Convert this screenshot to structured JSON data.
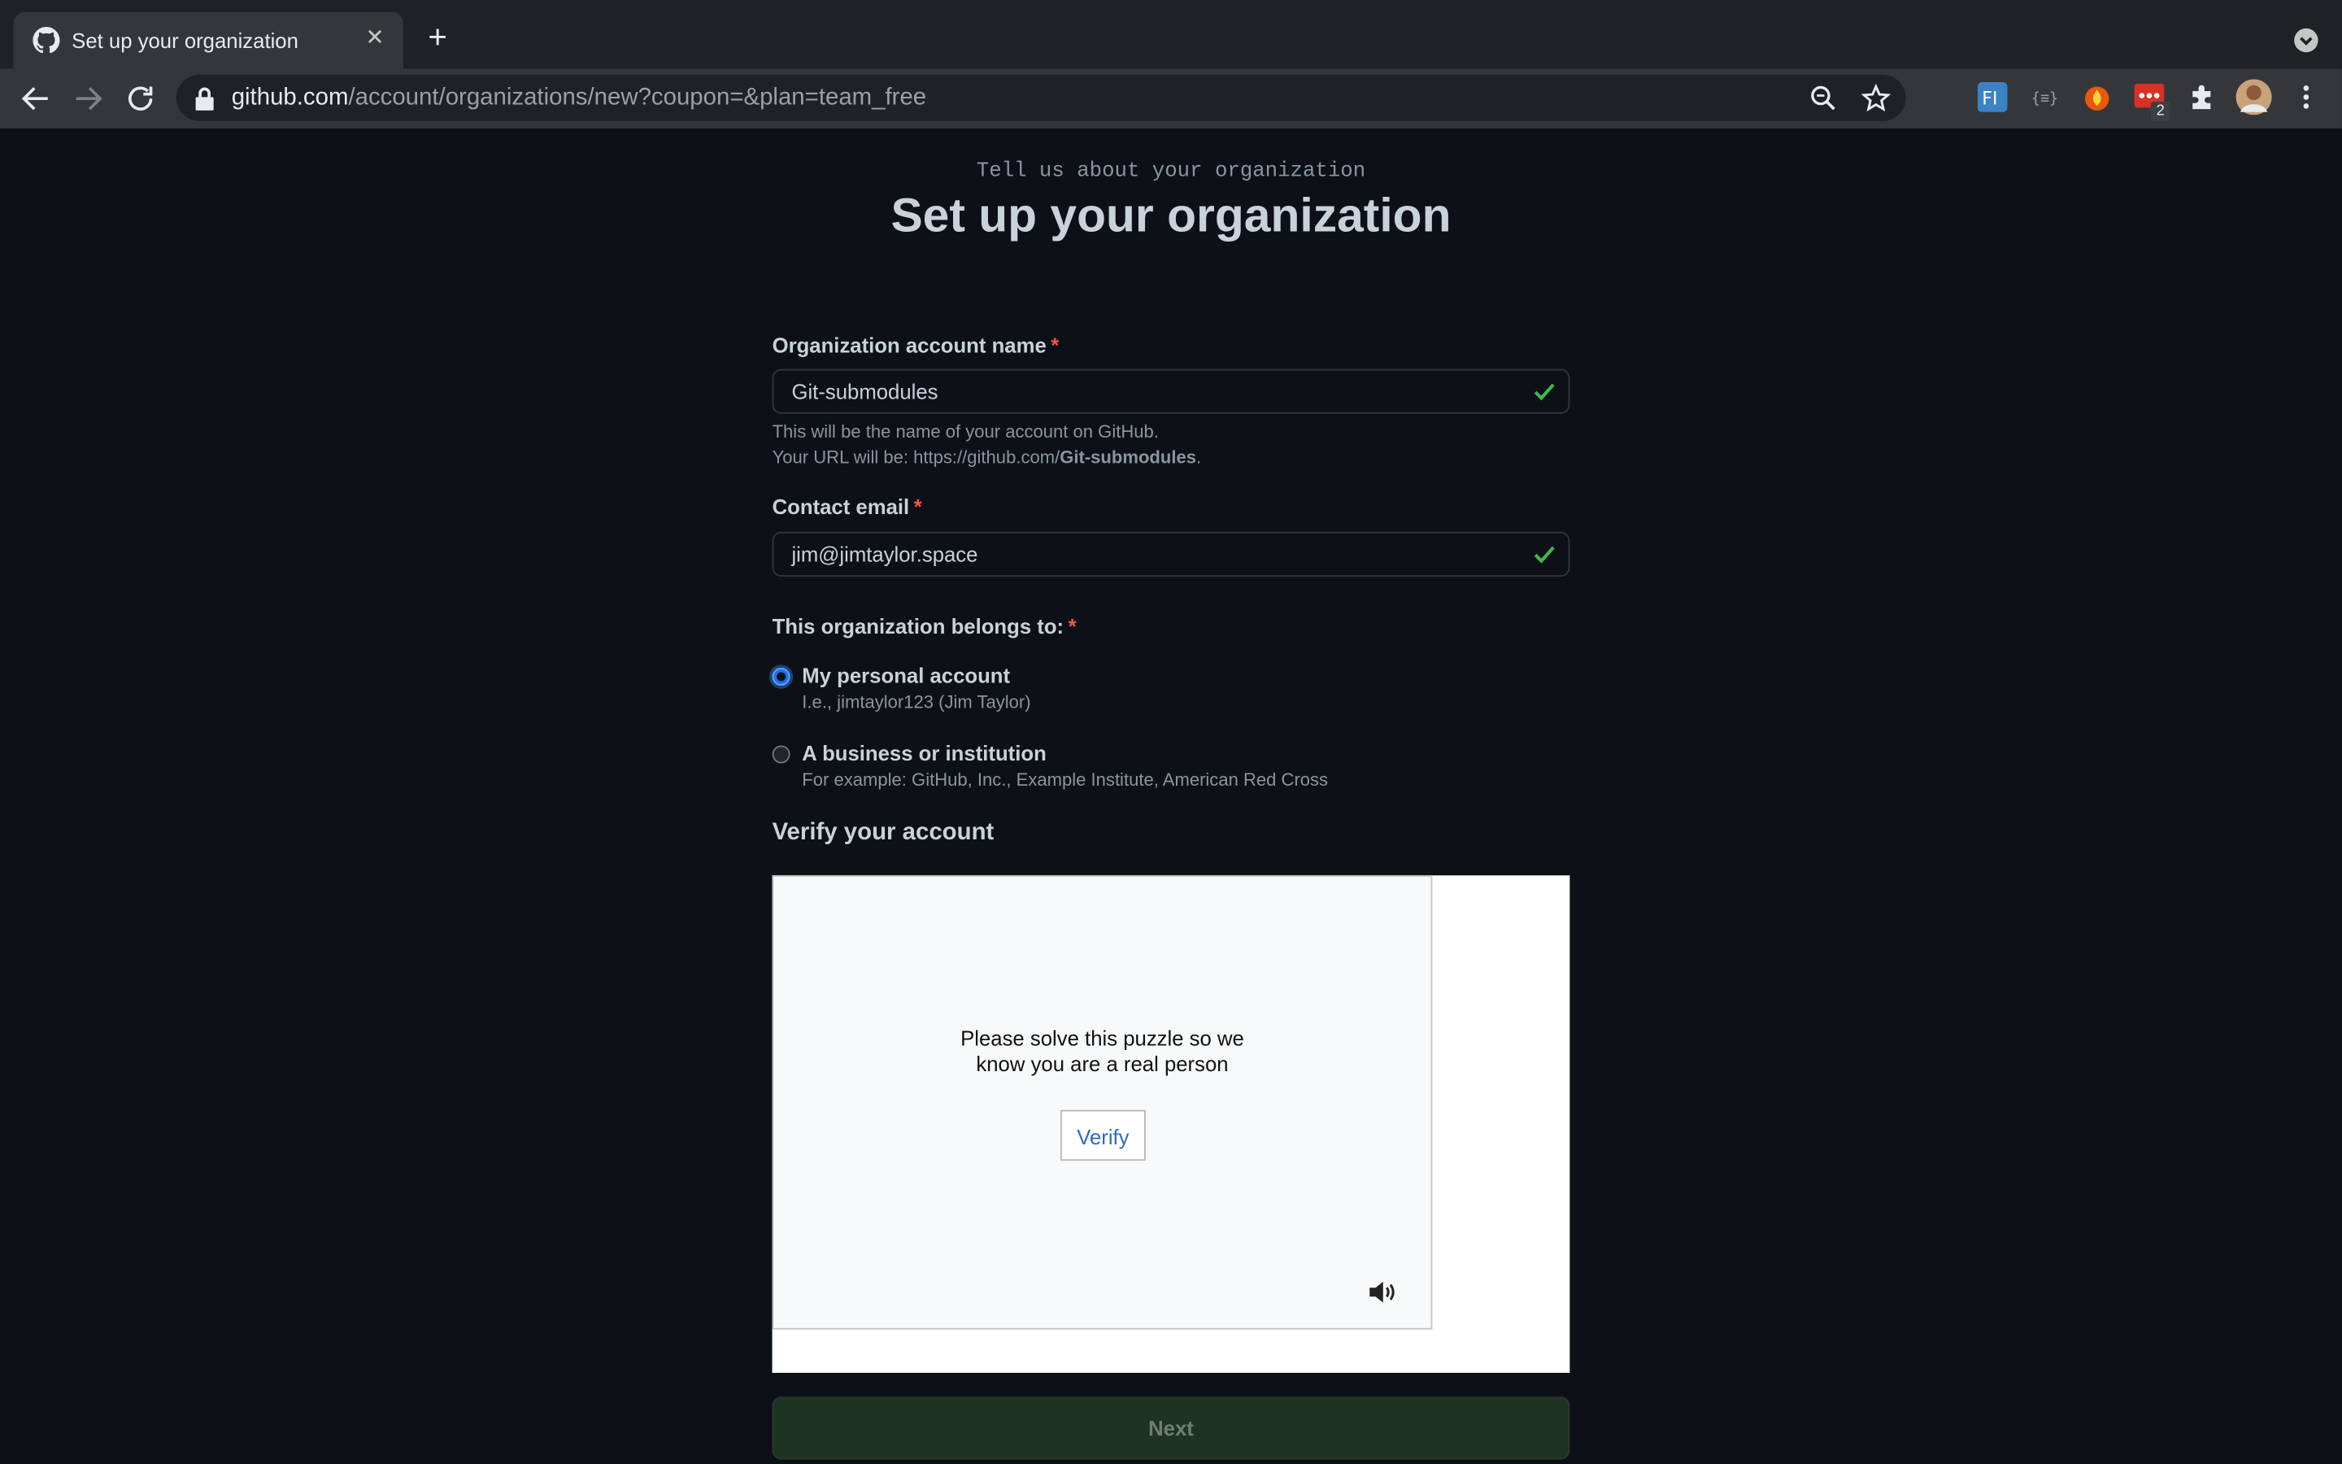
{
  "browser": {
    "tab_title": "Set up your organization",
    "url_host": "github.com",
    "url_path": "/account/organizations/new?coupon=&plan=team_free",
    "extension_badge": "2"
  },
  "header": {
    "subtitle": "Tell us about your organization",
    "title": "Set up your organization"
  },
  "form": {
    "org_name": {
      "label": "Organization account name",
      "required_mark": "*",
      "value": "Git-submodules",
      "note_line1": "This will be the name of your account on GitHub.",
      "note_line2_prefix": "Your URL will be: https://github.com/",
      "note_line2_name": "Git-submodules",
      "note_line2_suffix": "."
    },
    "email": {
      "label": "Contact email",
      "required_mark": "*",
      "value": "jim@jimtaylor.space"
    },
    "belongs_to": {
      "label": "This organization belongs to:",
      "required_mark": "*",
      "options": [
        {
          "label": "My personal account",
          "desc": "I.e., jimtaylor123 (Jim Taylor)",
          "checked": true
        },
        {
          "label": "A business or institution",
          "desc": "For example: GitHub, Inc., Example Institute, American Red Cross",
          "checked": false
        }
      ]
    },
    "verify": {
      "title": "Verify your account",
      "prompt_line1": "Please solve this puzzle so we",
      "prompt_line2": "know you are a real person",
      "button": "Verify"
    },
    "next_button": "Next"
  },
  "colors": {
    "background": "#0d1117",
    "accent_green": "#2ea043",
    "required_red": "#f85149"
  }
}
